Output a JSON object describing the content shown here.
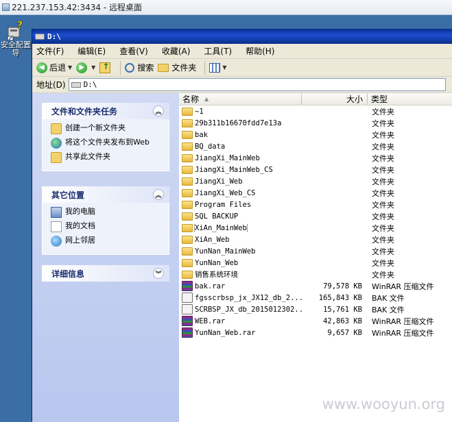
{
  "rdp": {
    "title": "221.237.153.42:3434 - 远程桌面"
  },
  "desktop_icon": {
    "label": "安全配置导"
  },
  "window": {
    "title": "D:\\"
  },
  "menu": [
    "文件(F)",
    "编辑(E)",
    "查看(V)",
    "收藏(A)",
    "工具(T)",
    "帮助(H)"
  ],
  "toolbar": {
    "back": "后退",
    "search": "搜索",
    "folders": "文件夹"
  },
  "address": {
    "label": "地址(D)",
    "value": "D:\\"
  },
  "tasks": {
    "title": "文件和文件夹任务",
    "items": [
      "创建一个新文件夹",
      "将这个文件夹发布到Web",
      "共享此文件夹"
    ]
  },
  "places": {
    "title": "其它位置",
    "items": [
      "我的电脑",
      "我的文档",
      "网上邻居"
    ]
  },
  "details": {
    "title": "详细信息"
  },
  "columns": {
    "name": "名称",
    "size": "大小",
    "type": "类型"
  },
  "files": [
    {
      "name": "~1",
      "size": "",
      "type": "文件夹",
      "icon": "folder"
    },
    {
      "name": "29b311b16670fdd7e13a",
      "size": "",
      "type": "文件夹",
      "icon": "folder"
    },
    {
      "name": "bak",
      "size": "",
      "type": "文件夹",
      "icon": "folder"
    },
    {
      "name": "BQ_data",
      "size": "",
      "type": "文件夹",
      "icon": "folder"
    },
    {
      "name": "JiangXi_MainWeb",
      "size": "",
      "type": "文件夹",
      "icon": "folder"
    },
    {
      "name": "JiangXi_MainWeb_CS",
      "size": "",
      "type": "文件夹",
      "icon": "folder"
    },
    {
      "name": "JiangXi_Web",
      "size": "",
      "type": "文件夹",
      "icon": "folder"
    },
    {
      "name": "JiangXi_Web_CS",
      "size": "",
      "type": "文件夹",
      "icon": "folder"
    },
    {
      "name": "Program Files",
      "size": "",
      "type": "文件夹",
      "icon": "folder"
    },
    {
      "name": "SQL BACKUP",
      "size": "",
      "type": "文件夹",
      "icon": "folder"
    },
    {
      "name": "XiAn_MainWeb",
      "size": "",
      "type": "文件夹",
      "icon": "folder"
    },
    {
      "name": "XiAn_Web",
      "size": "",
      "type": "文件夹",
      "icon": "folder"
    },
    {
      "name": "YunNan_MainWeb",
      "size": "",
      "type": "文件夹",
      "icon": "folder"
    },
    {
      "name": "YunNan_Web",
      "size": "",
      "type": "文件夹",
      "icon": "folder"
    },
    {
      "name": "销售系统环境",
      "size": "",
      "type": "文件夹",
      "icon": "folder"
    },
    {
      "name": "bak.rar",
      "size": "79,578 KB",
      "type": "WinRAR 压缩文件",
      "icon": "rar"
    },
    {
      "name": "fgsscrbsp_jx_JX12_db_2...",
      "size": "165,843 KB",
      "type": "BAK 文件",
      "icon": "bak"
    },
    {
      "name": "SCRBSP_JX_db_2015012302...",
      "size": "15,761 KB",
      "type": "BAK 文件",
      "icon": "bak"
    },
    {
      "name": "WEB.rar",
      "size": "42,863 KB",
      "type": "WinRAR 压缩文件",
      "icon": "rar"
    },
    {
      "name": "YunNan_Web.rar",
      "size": "9,657 KB",
      "type": "WinRAR 压缩文件",
      "icon": "rar"
    }
  ],
  "watermark": "www.wooyun.org"
}
